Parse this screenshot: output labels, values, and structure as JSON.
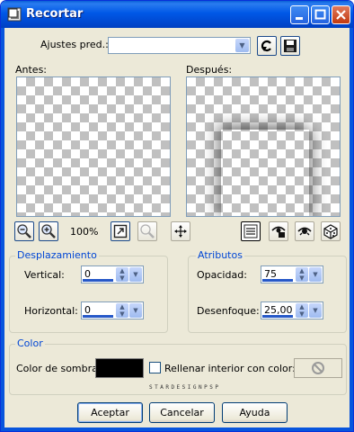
{
  "window": {
    "title": "Recortar"
  },
  "presets": {
    "label": "Ajustes pred.:",
    "value": ""
  },
  "preview": {
    "before_label": "Antes:",
    "after_label": "Después:"
  },
  "zoom": {
    "level": "100%"
  },
  "offset": {
    "title": "Desplazamiento",
    "vertical_label": "Vertical:",
    "vertical_value": "0",
    "horizontal_label": "Horizontal:",
    "horizontal_value": "0"
  },
  "attributes": {
    "title": "Atributos",
    "opacity_label": "Opacidad:",
    "opacity_value": "75",
    "blur_label": "Desenfoque:",
    "blur_value": "25,00"
  },
  "color": {
    "title": "Color",
    "shadow_label": "Color de sombra:",
    "shadow_color": "#000000",
    "fill_label": "Rellenar interior con color:",
    "fill_checked": false
  },
  "watermark": "STARDESIGNPSP",
  "buttons": {
    "ok": "Aceptar",
    "cancel": "Cancelar",
    "help": "Ayuda"
  }
}
